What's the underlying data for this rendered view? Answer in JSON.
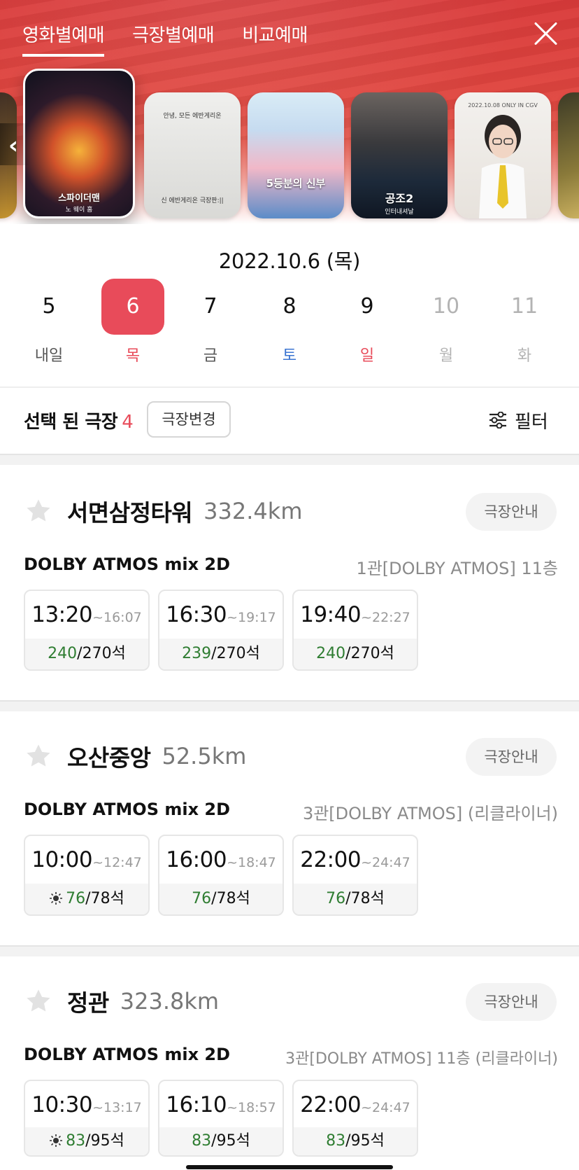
{
  "header": {
    "tabs": [
      {
        "label": "영화별예매",
        "active": true
      },
      {
        "label": "극장별예매",
        "active": false
      },
      {
        "label": "비교예매",
        "active": false
      }
    ],
    "close_icon": "close-icon",
    "posters": [
      {
        "title": "",
        "subtitle": ""
      },
      {
        "title": "스파이더맨",
        "subtitle": "노 웨이 홈"
      },
      {
        "text_top": "안녕, 모든 에반게리온",
        "text_bottom": "신 에반게리온 극장판:||"
      },
      {
        "title": "5등분의 신부",
        "subtitle": ""
      },
      {
        "title": "공조2",
        "subtitle": "인터내셔날"
      },
      {
        "text_top": "2022.10.08 ONLY IN CGV",
        "text_bottom": ""
      },
      {
        "title": "",
        "subtitle": ""
      }
    ]
  },
  "date": {
    "title": "2022.10.6 (목)",
    "days": [
      {
        "num": "5",
        "label": "내일",
        "state": "normal"
      },
      {
        "num": "6",
        "label": "목",
        "state": "selected"
      },
      {
        "num": "7",
        "label": "금",
        "state": "normal"
      },
      {
        "num": "8",
        "label": "토",
        "state": "sat"
      },
      {
        "num": "9",
        "label": "일",
        "state": "sun"
      },
      {
        "num": "10",
        "label": "월",
        "state": "off"
      },
      {
        "num": "11",
        "label": "화",
        "state": "off"
      }
    ]
  },
  "selection": {
    "label": "선택 된 극장",
    "count": "4",
    "change_label": "극장변경",
    "filter_label": "필터"
  },
  "theaters": [
    {
      "name": "서면삼정타워",
      "distance": "332.4km",
      "info_label": "극장안내",
      "format": "DOLBY ATMOS mix 2D",
      "hall": "1관[DOLBY ATMOS] 11층",
      "showtimes": [
        {
          "start": "13:20",
          "end": "~16:07",
          "avail": "240",
          "total": "/270석",
          "morning": false
        },
        {
          "start": "16:30",
          "end": "~19:17",
          "avail": "239",
          "total": "/270석",
          "morning": false
        },
        {
          "start": "19:40",
          "end": "~22:27",
          "avail": "240",
          "total": "/270석",
          "morning": false
        }
      ]
    },
    {
      "name": "오산중앙",
      "distance": "52.5km",
      "info_label": "극장안내",
      "format": "DOLBY ATMOS mix 2D",
      "hall": "3관[DOLBY ATMOS] (리클라이너)",
      "showtimes": [
        {
          "start": "10:00",
          "end": "~12:47",
          "avail": "76",
          "total": "/78석",
          "morning": true
        },
        {
          "start": "16:00",
          "end": "~18:47",
          "avail": "76",
          "total": "/78석",
          "morning": false
        },
        {
          "start": "22:00",
          "end": "~24:47",
          "avail": "76",
          "total": "/78석",
          "morning": false
        }
      ]
    },
    {
      "name": "정관",
      "distance": "323.8km",
      "info_label": "극장안내",
      "format": "DOLBY ATMOS mix 2D",
      "hall": "3관[DOLBY ATMOS] 11층 (리클라이너)",
      "showtimes": [
        {
          "start": "10:30",
          "end": "~13:17",
          "avail": "83",
          "total": "/95석",
          "morning": true
        },
        {
          "start": "16:10",
          "end": "~18:57",
          "avail": "83",
          "total": "/95석",
          "morning": false
        },
        {
          "start": "22:00",
          "end": "~24:47",
          "avail": "83",
          "total": "/95석",
          "morning": false
        }
      ]
    }
  ],
  "colors": {
    "accent": "#e84b5a",
    "available": "#2f7d32",
    "saturday": "#3b74d1"
  }
}
